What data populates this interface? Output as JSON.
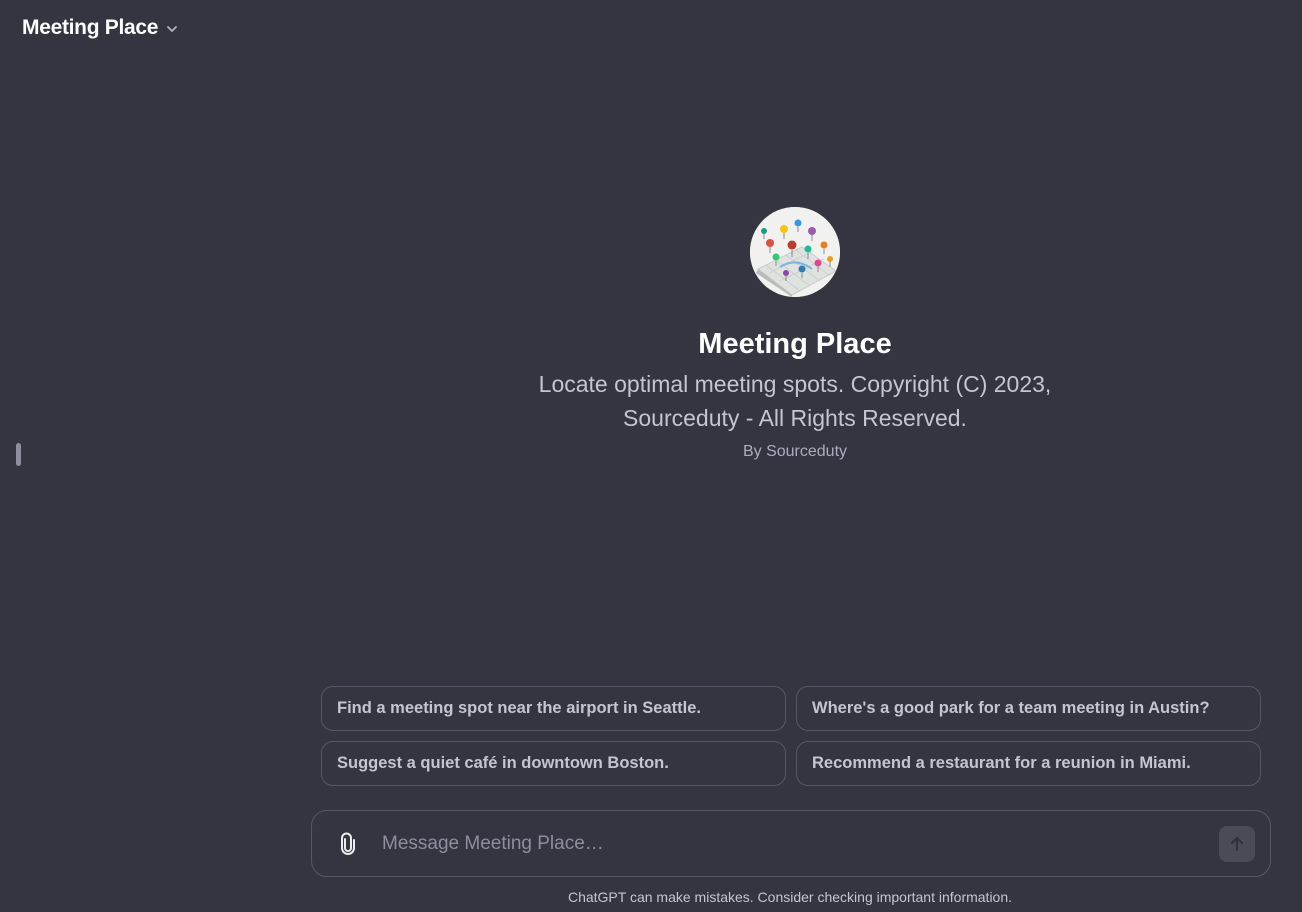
{
  "header": {
    "title": "Meeting Place",
    "dropdown_icon": "chevron-down-icon"
  },
  "gpt": {
    "name": "Meeting Place",
    "description": "Locate optimal meeting spots. Copyright (C) 2023, Sourceduty - All Rights Reserved.",
    "author": "By Sourceduty",
    "avatar_icon": "map-pins-avatar"
  },
  "suggestions": [
    {
      "label": "Find a meeting spot near the airport in Seattle."
    },
    {
      "label": "Where's a good park for a team meeting in Austin?"
    },
    {
      "label": "Suggest a quiet café in downtown Boston."
    },
    {
      "label": "Recommend a restaurant for a reunion in Miami."
    }
  ],
  "composer": {
    "placeholder": "Message Meeting Place…",
    "value": "",
    "attach_icon": "paperclip-icon",
    "send_icon": "arrow-up-icon"
  },
  "footer": {
    "disclaimer": "ChatGPT can make mistakes. Consider checking important information."
  },
  "colors": {
    "background": "#343541",
    "border": "#565869",
    "text_primary": "#ffffff",
    "text_secondary": "#c5c5d2"
  }
}
